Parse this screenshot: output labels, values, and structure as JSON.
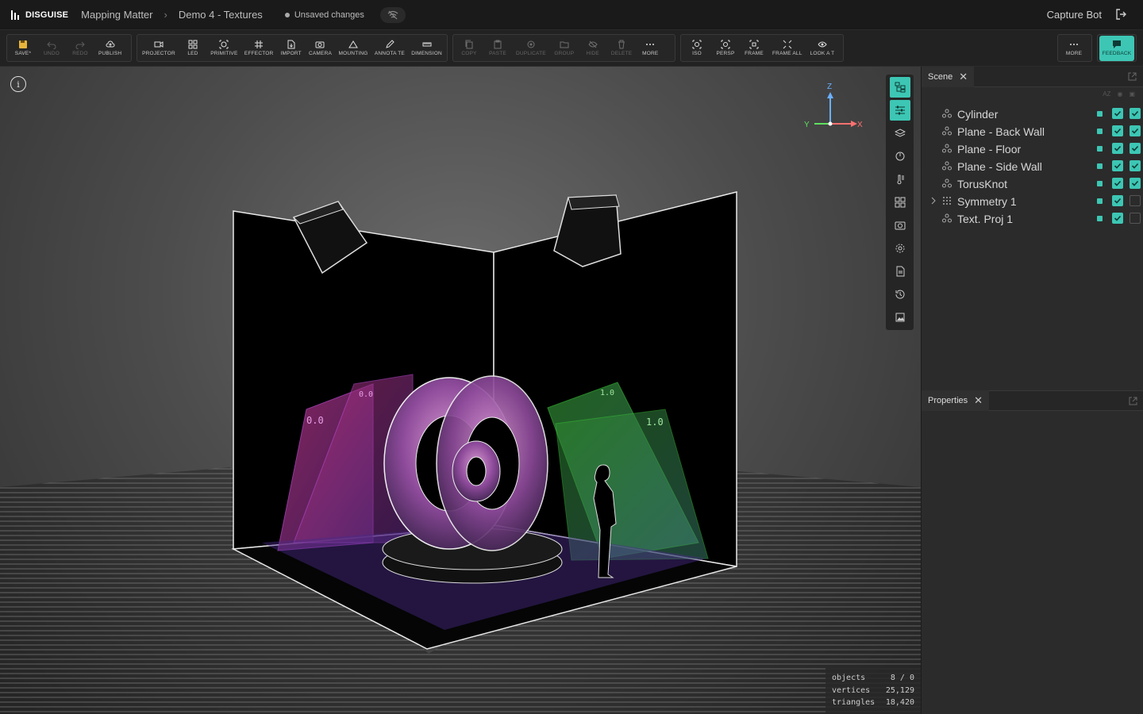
{
  "header": {
    "brand": "DISGUISE",
    "project": "Mapping Matter",
    "file": "Demo 4 - Textures",
    "status": "Unsaved changes",
    "user": "Capture Bot"
  },
  "toolbar": {
    "save": "SAVE*",
    "undo": "UNDO",
    "redo": "REDO",
    "publish": "PUBLISH",
    "projector": "PROJECTOR",
    "led": "LED",
    "primitive": "PRIMITIVE",
    "effector": "EFFECTOR",
    "import": "IMPORT",
    "camera": "CAMERA",
    "mounting": "MOUNTING",
    "annotate": "ANNOTA TE",
    "dimension": "DIMENSION",
    "copy": "COPY",
    "paste": "PASTE",
    "duplicate": "DUPLICATE",
    "group": "GROUP",
    "hide": "HIDE",
    "delete": "DELETE",
    "more": "MORE",
    "iso": "ISO",
    "persp": "PERSP",
    "frame": "FRAME",
    "frame_all": "FRAME ALL",
    "look_at": "LOOK A T",
    "more2": "MORE",
    "feedback": "FEEDBACK"
  },
  "viewport": {
    "axis_z": "Z",
    "axis_y": "Y",
    "axis_x": "X",
    "tex_labels": [
      "0.0",
      "0.0",
      "1.0",
      "1.0"
    ],
    "stats": [
      {
        "label": "objects",
        "value": "8 / 0"
      },
      {
        "label": "vertices",
        "value": "25,129"
      },
      {
        "label": "triangles",
        "value": "18,420"
      }
    ]
  },
  "scene_panel": {
    "tab": "Scene",
    "sort_label": "AZ",
    "items": [
      {
        "label": "Cylinder",
        "visible": true,
        "locked": true
      },
      {
        "label": "Plane - Back Wall",
        "visible": true,
        "locked": true
      },
      {
        "label": "Plane - Floor",
        "visible": true,
        "locked": true
      },
      {
        "label": "Plane - Side Wall",
        "visible": true,
        "locked": true
      },
      {
        "label": "TorusKnot",
        "visible": true,
        "locked": true
      },
      {
        "label": "Symmetry 1",
        "visible": true,
        "locked": false
      },
      {
        "label": "Text. Proj 1",
        "visible": true,
        "locked": false
      }
    ]
  },
  "properties_panel": {
    "tab": "Properties"
  },
  "colors": {
    "accent": "#3dc6b4",
    "save_icon": "#e6b43c",
    "background": "#1b1b1b"
  }
}
